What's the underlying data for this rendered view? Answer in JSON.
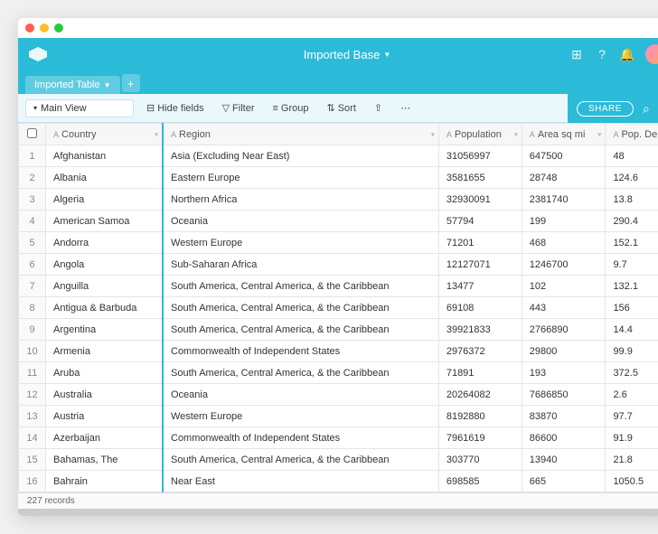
{
  "base_title": "Imported Base",
  "tab_label": "Imported Table",
  "view_name": "Main View",
  "toolbar": {
    "hide_fields": "Hide fields",
    "filter": "Filter",
    "group": "Group",
    "sort": "Sort",
    "share": "SHARE"
  },
  "columns": [
    {
      "name": "Country",
      "type": "A"
    },
    {
      "name": "Region",
      "type": "A"
    },
    {
      "name": "Population",
      "type": "A"
    },
    {
      "name": "Area sq mi",
      "type": "A"
    },
    {
      "name": "Pop. De",
      "type": "A"
    }
  ],
  "rows": [
    {
      "n": "1",
      "country": "Afghanistan",
      "region": "Asia (Excluding Near East)",
      "population": "31056997",
      "area": "647500",
      "density": "48"
    },
    {
      "n": "2",
      "country": "Albania",
      "region": "Eastern Europe",
      "population": "3581655",
      "area": "28748",
      "density": "124.6"
    },
    {
      "n": "3",
      "country": "Algeria",
      "region": "Northern Africa",
      "population": "32930091",
      "area": "2381740",
      "density": "13.8"
    },
    {
      "n": "4",
      "country": "American Samoa",
      "region": "Oceania",
      "population": "57794",
      "area": "199",
      "density": "290.4"
    },
    {
      "n": "5",
      "country": "Andorra",
      "region": "Western Europe",
      "population": "71201",
      "area": "468",
      "density": "152.1"
    },
    {
      "n": "6",
      "country": "Angola",
      "region": "Sub-Saharan Africa",
      "population": "12127071",
      "area": "1246700",
      "density": "9.7"
    },
    {
      "n": "7",
      "country": "Anguilla",
      "region": "South America, Central America, & the Caribbean",
      "population": "13477",
      "area": "102",
      "density": "132.1"
    },
    {
      "n": "8",
      "country": "Antigua & Barbuda",
      "region": "South America, Central America, & the Caribbean",
      "population": "69108",
      "area": "443",
      "density": "156"
    },
    {
      "n": "9",
      "country": "Argentina",
      "region": "South America, Central America, & the Caribbean",
      "population": "39921833",
      "area": "2766890",
      "density": "14.4"
    },
    {
      "n": "10",
      "country": "Armenia",
      "region": "Commonwealth of Independent States",
      "population": "2976372",
      "area": "29800",
      "density": "99.9"
    },
    {
      "n": "11",
      "country": "Aruba",
      "region": "South America, Central America, & the Caribbean",
      "population": "71891",
      "area": "193",
      "density": "372.5"
    },
    {
      "n": "12",
      "country": "Australia",
      "region": "Oceania",
      "population": "20264082",
      "area": "7686850",
      "density": "2.6"
    },
    {
      "n": "13",
      "country": "Austria",
      "region": "Western Europe",
      "population": "8192880",
      "area": "83870",
      "density": "97.7"
    },
    {
      "n": "14",
      "country": "Azerbaijan",
      "region": "Commonwealth of Independent States",
      "population": "7961619",
      "area": "86600",
      "density": "91.9"
    },
    {
      "n": "15",
      "country": "Bahamas, The",
      "region": "South America, Central America, & the Caribbean",
      "population": "303770",
      "area": "13940",
      "density": "21.8"
    },
    {
      "n": "16",
      "country": "Bahrain",
      "region": "Near East",
      "population": "698585",
      "area": "665",
      "density": "1050.5"
    }
  ],
  "record_count": "227 records"
}
